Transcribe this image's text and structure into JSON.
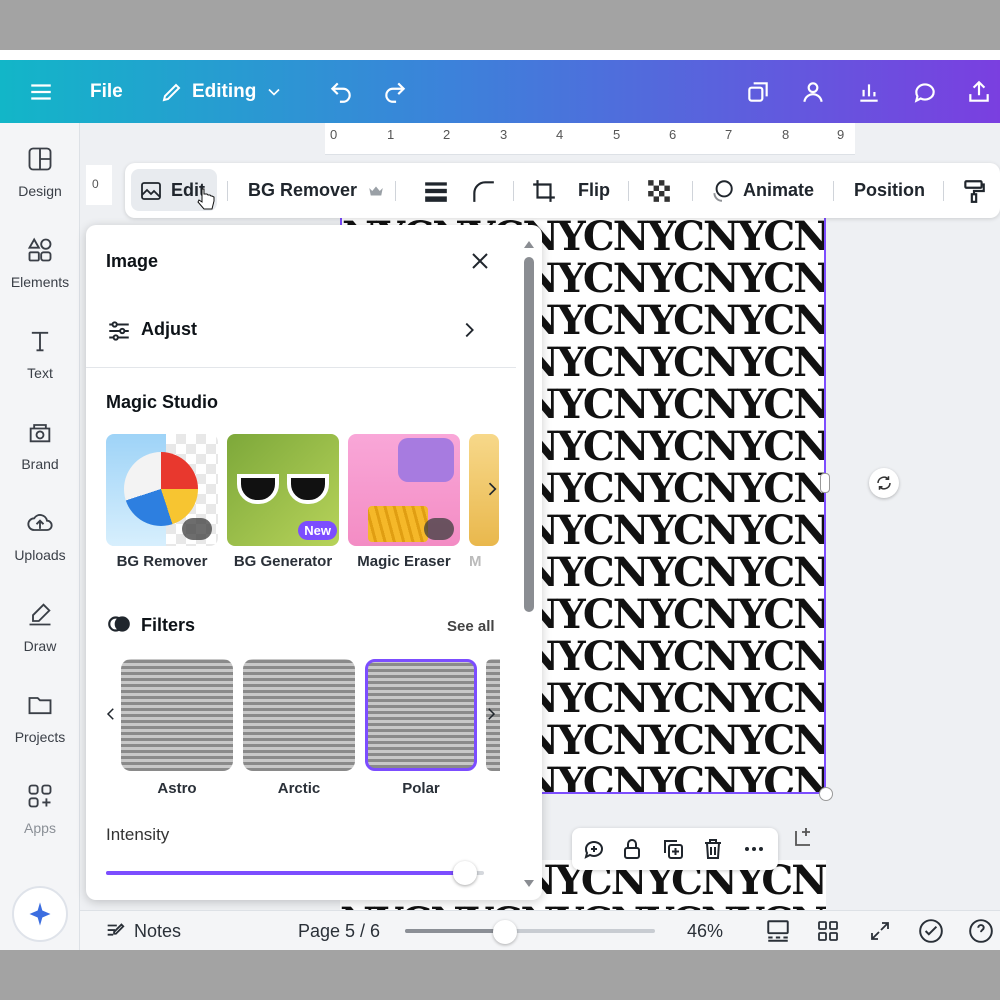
{
  "topbar": {
    "file_label": "File",
    "editing_label": "Editing"
  },
  "sidebar": {
    "items": [
      {
        "label": "Design"
      },
      {
        "label": "Elements"
      },
      {
        "label": "Text"
      },
      {
        "label": "Brand"
      },
      {
        "label": "Uploads"
      },
      {
        "label": "Draw"
      },
      {
        "label": "Projects"
      },
      {
        "label": "Apps"
      }
    ]
  },
  "ruler": {
    "ticks": [
      "0",
      "1",
      "2",
      "3",
      "4",
      "5",
      "6",
      "7",
      "8",
      "9"
    ],
    "left_tick": "0"
  },
  "toolbar": {
    "edit_label": "Edit",
    "bg_remover_label": "BG Remover",
    "flip_label": "Flip",
    "animate_label": "Animate",
    "position_label": "Position"
  },
  "panel": {
    "title": "Image",
    "adjust_label": "Adjust",
    "magic_studio_title": "Magic Studio",
    "tools": [
      {
        "label": "BG Remover"
      },
      {
        "label": "BG Generator",
        "badge": "New"
      },
      {
        "label": "Magic Eraser"
      },
      {
        "label": "M"
      }
    ],
    "filters_title": "Filters",
    "see_all_label": "See all",
    "filters": [
      {
        "label": "Astro"
      },
      {
        "label": "Arctic"
      },
      {
        "label": "Polar"
      }
    ],
    "intensity_label": "Intensity",
    "intensity_value": 0.95
  },
  "canvas": {
    "pattern_text": "NYC"
  },
  "bottombar": {
    "notes_label": "Notes",
    "page_label": "Page 5 / 6",
    "zoom_label": "46%",
    "zoom_value": 0.4
  },
  "colors": {
    "accent": "#7c4dff",
    "gradient_start": "#12b6c8",
    "gradient_end": "#7a3fe0"
  }
}
